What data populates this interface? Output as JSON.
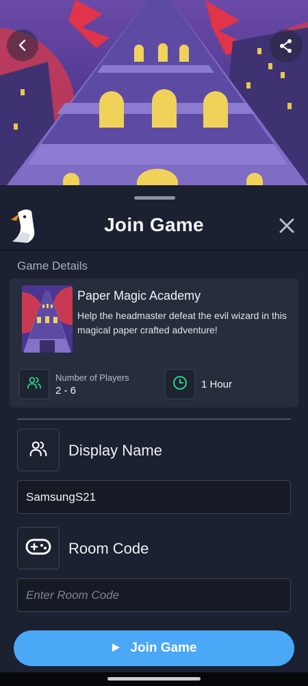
{
  "sheet": {
    "title": "Join Game",
    "section_label": "Game Details"
  },
  "game": {
    "name": "Paper Magic Academy",
    "description": "Help the headmaster defeat the evil wizard in this magical paper crafted adventure!",
    "players_label": "Number of Players",
    "players_value": "2 - 6",
    "duration": "1 Hour"
  },
  "form": {
    "display_name_label": "Display Name",
    "display_name_value": "SamsungS21",
    "room_code_label": "Room Code",
    "room_code_placeholder": "Enter Room Code",
    "room_code_value": ""
  },
  "actions": {
    "join_label": "Join Game"
  },
  "icons": {
    "back": "chevron-left-icon",
    "share": "share-icon",
    "close": "close-icon",
    "players": "users-icon",
    "time": "clock-icon",
    "display_name": "users-icon",
    "room_code": "gamepad-icon",
    "join": "play-icon"
  },
  "colors": {
    "sheet_bg": "#1b2130",
    "card_bg": "#262d3c",
    "accent_green": "#2ecf8a",
    "join_button": "#4aa8f6"
  }
}
